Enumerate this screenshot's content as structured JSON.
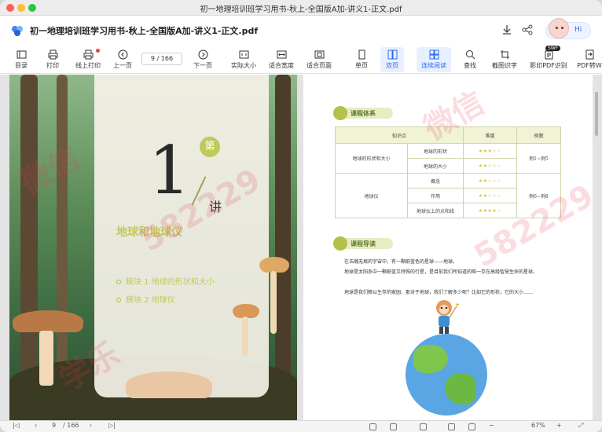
{
  "window": {
    "title": "初一地理培训班学习用书-秋上-全国版A加-讲义1-正文.pdf"
  },
  "doc": {
    "title": "初一地理培训班学习用书-秋上-全国版A加-讲义1-正文.pdf",
    "hi_label": "Hi",
    "swf_badge": "SWF"
  },
  "toolbar": {
    "items": [
      {
        "label": "目录",
        "icon": "toc-icon"
      },
      {
        "label": "打印",
        "icon": "printer-icon"
      },
      {
        "label": "线上打印",
        "icon": "online-print-icon"
      },
      {
        "label": "上一页",
        "icon": "prev-page-icon"
      },
      {
        "label": "下一页",
        "icon": "next-page-icon"
      },
      {
        "label": "实际大小",
        "icon": "actual-size-icon"
      },
      {
        "label": "适合宽度",
        "icon": "fit-width-icon"
      },
      {
        "label": "适合页面",
        "icon": "fit-page-icon"
      },
      {
        "label": "单页",
        "icon": "single-page-icon"
      },
      {
        "label": "双页",
        "icon": "double-page-icon"
      },
      {
        "label": "连续阅读",
        "icon": "continuous-icon"
      },
      {
        "label": "查找",
        "icon": "search-icon"
      },
      {
        "label": "截图识字",
        "icon": "screenshot-ocr-icon"
      },
      {
        "label": "影印PDF识别",
        "icon": "ocr-pdf-icon"
      },
      {
        "label": "PDF转W",
        "icon": "pdf-convert-icon"
      }
    ],
    "page_input": "9",
    "page_total": "/ 166"
  },
  "left_page": {
    "numeral": "1",
    "di_char": "第",
    "jiang_char": "讲",
    "title": "地球和地球仪",
    "modules": [
      {
        "label": "模块 1    地球的形状和大小"
      },
      {
        "label": "模块 2    地球仪"
      }
    ]
  },
  "right_page": {
    "section1": "课程体系",
    "table": {
      "headers": [
        "知识点",
        "难度",
        "例题"
      ],
      "rows": [
        {
          "group": "地球的形状和大小",
          "point": "地球的形状",
          "stars": "★★★☆☆",
          "example": "例1~例5"
        },
        {
          "group": "",
          "point": "地球的大小",
          "stars": "★★☆☆☆",
          "example": ""
        },
        {
          "group": "地球仪",
          "point": "概念",
          "stars": "★★☆☆☆",
          "example": "例6~例8"
        },
        {
          "group": "",
          "point": "作用",
          "stars": "★★☆☆☆",
          "example": ""
        },
        {
          "group": "",
          "point": "地球仪上的点和线",
          "stars": "★★★★☆",
          "example": ""
        }
      ]
    },
    "section2": "课程导读",
    "paragraphs": [
      "在浩瀚无垠的宇宙中，有一颗蔚蓝色的星球——地球。",
      "地球是太阳系中一颗蔚蓝又特殊的行星，是目前我们所知道的唯一存在高级智慧生命的星球。",
      "地球是我们赖以生存的家园，那对于地球，我们了解多少呢？比如它的形状，它的大小……"
    ]
  },
  "watermarks": [
    "微信",
    "582229",
    "学乐",
    "微信",
    "582229"
  ],
  "statusbar": {
    "page": "9",
    "total": "/ 166",
    "zoom": "67%"
  },
  "colors": {
    "accent": "#2f6be4",
    "title_green": "#c3c85a",
    "table_border": "#cfd4a6"
  }
}
